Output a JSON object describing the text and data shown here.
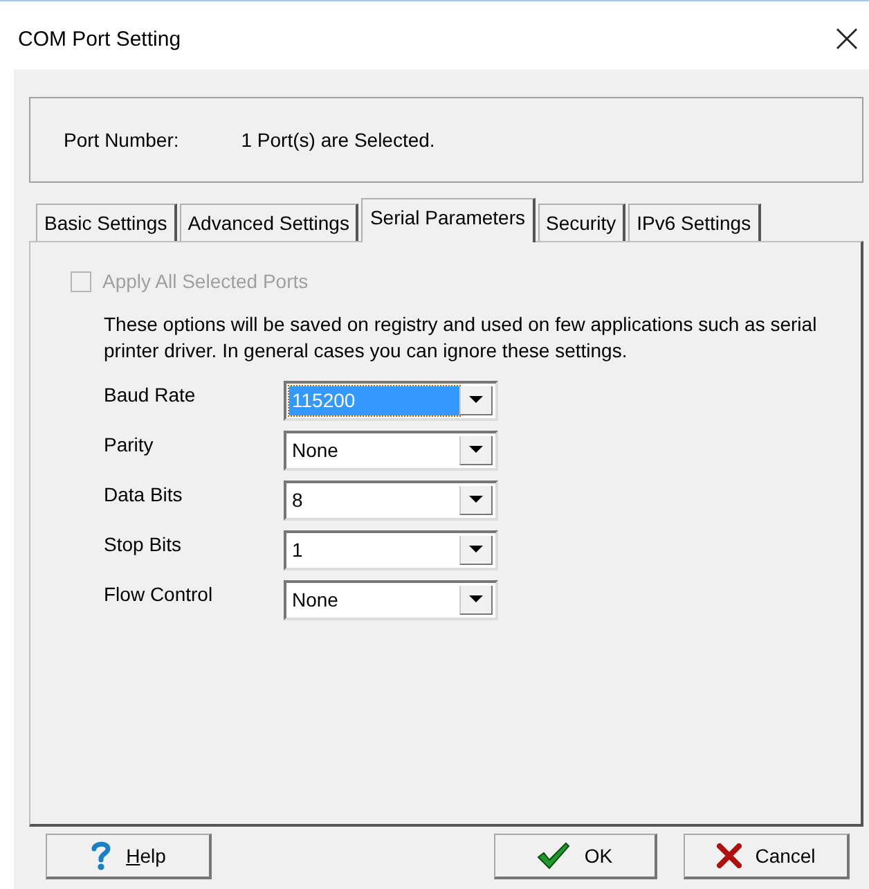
{
  "window": {
    "title": "COM Port Setting"
  },
  "port": {
    "label": "Port Number:",
    "value": "1 Port(s) are Selected."
  },
  "tabs": [
    {
      "label": "Basic Settings",
      "selected": false
    },
    {
      "label": "Advanced Settings",
      "selected": false
    },
    {
      "label": "Serial Parameters",
      "selected": true
    },
    {
      "label": "Security",
      "selected": false
    },
    {
      "label": "IPv6 Settings",
      "selected": false
    }
  ],
  "apply_all": {
    "label": "Apply All Selected Ports",
    "checked": false,
    "disabled": true
  },
  "description": "These options will be saved on registry and used on few applications such as serial printer driver. In general cases you can ignore these settings.",
  "fields": [
    {
      "label": "Baud Rate",
      "value": "115200",
      "focused": true
    },
    {
      "label": "Parity",
      "value": "None",
      "focused": false
    },
    {
      "label": "Data Bits",
      "value": "8",
      "focused": false
    },
    {
      "label": "Stop Bits",
      "value": "1",
      "focused": false
    },
    {
      "label": "Flow Control",
      "value": "None",
      "focused": false
    }
  ],
  "buttons": [
    {
      "kind": "help",
      "mnemonic": "H",
      "label": "elp"
    },
    {
      "kind": "ok",
      "label": "OK"
    },
    {
      "kind": "cancel",
      "label": "Cancel"
    }
  ]
}
